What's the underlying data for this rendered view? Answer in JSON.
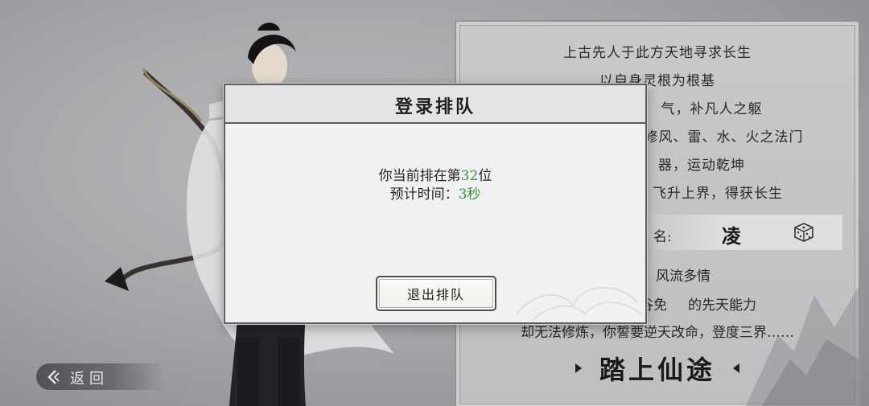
{
  "lore": {
    "lines": [
      "上古先人于此方天地寻求长生",
      "以自身灵根为根基"
    ],
    "line3_visible": "气，补凡人之躯",
    "line4_visible": "修风、雷、水、火之法门",
    "line5_visible": "器，运动乾坤",
    "line6_visible": "飞升上界，得获长生",
    "name_label": "名:",
    "name_value": "凌",
    "trait": "风流多情",
    "ability_a": "谷免",
    "ability_b": "的先天能力",
    "last_line": "却无法修炼，你誓要逆天改命，登度三界……",
    "start_label": "踏上仙途",
    "icons": {
      "dice": "dice-icon",
      "mountain": "mountain-ink-icon"
    }
  },
  "back": {
    "label": "返回",
    "icon": "back-arrow-icon"
  },
  "dialog": {
    "title": "登录排队",
    "queue_prefix": "你当前排在第",
    "queue_position": "32",
    "queue_suffix": "位",
    "time_prefix": "预计时间：",
    "time_value": "3秒",
    "exit_label": "退出排队"
  },
  "colors": {
    "accent": "#2e9b3a",
    "panel_border": "#5e5e60",
    "background": "#a9aaad"
  }
}
